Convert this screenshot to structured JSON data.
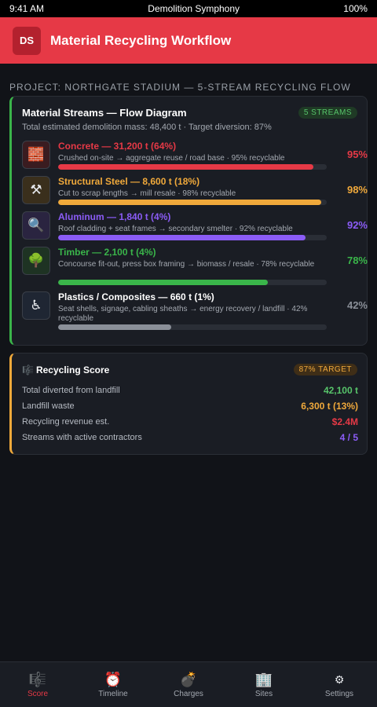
{
  "status_bar": {
    "time": "9:41 AM",
    "carrier": "Demolition Symphony",
    "battery": "100%"
  },
  "header": {
    "logo": "DS",
    "title": "Material Recycling Workflow"
  },
  "project_label": "PROJECT: NORTHGATE STADIUM — 5-STREAM RECYCLING FLOW",
  "flow_card": {
    "title": "Material Streams — Flow Diagram",
    "badge": "5 STREAMS",
    "subtitle": "Total estimated demolition mass: 48,400 t · Target diversion: 87%",
    "streams": [
      {
        "icon": "brick-icon",
        "glyph": "🧱",
        "name": "Concrete — 31,200 t (64%)",
        "desc": "Crushed on-site → aggregate reuse / road base · 95% recyclable",
        "pct": "95%",
        "fill": 0.95,
        "color": "#e63946",
        "icon_bg": "#3a1c20"
      },
      {
        "icon": "hammer-pick-icon",
        "glyph": "⚒",
        "name": "Structural Steel — 8,600 t (18%)",
        "desc": "Cut to scrap lengths → mill resale · 98% recyclable",
        "pct": "98%",
        "fill": 0.98,
        "color": "#f0a93b",
        "icon_bg": "#3a2f1c"
      },
      {
        "icon": "magnifier-icon",
        "glyph": "🔍",
        "name": "Aluminum — 1,840 t (4%)",
        "desc": "Roof cladding + seat frames → secondary smelter · 92% recyclable",
        "pct": "92%",
        "fill": 0.92,
        "color": "#8b5cf6",
        "icon_bg": "#2a2440"
      },
      {
        "icon": "tree-icon",
        "glyph": "🌳",
        "name": "Timber — 2,100 t (4%)",
        "desc": "Concourse fit-out, press box framing → biomass / resale · 78% recyclable",
        "pct": "78%",
        "fill": 0.78,
        "color": "#3ab54a",
        "icon_bg": "#1e3323"
      },
      {
        "icon": "wheelchair-icon",
        "glyph": "♿",
        "name": "Plastics / Composites — 660 t (1%)",
        "desc": "Seat shells, signage, cabling sheaths → energy recovery / landfill · 42% recyclable",
        "pct": "42%",
        "fill": 0.42,
        "color": "#8a8f98",
        "name_color": "#ffffff",
        "icon_bg": "#1f2633"
      }
    ]
  },
  "score_card": {
    "title": "Recycling Score",
    "title_icon": "music-score-icon",
    "badge": "87% TARGET",
    "rows": [
      {
        "label": "Total diverted from landfill",
        "value": "42,100 t",
        "color": "#57c46a"
      },
      {
        "label": "Landfill waste",
        "value": "6,300 t (13%)",
        "color": "#f0a93b"
      },
      {
        "label": "Recycling revenue est.",
        "value": "$2.4M",
        "color": "#e63946"
      },
      {
        "label": "Streams with active contractors",
        "value": "4 / 5",
        "color": "#8b5cf6"
      }
    ]
  },
  "tabs": [
    {
      "label": "Score",
      "icon": "music-score-icon",
      "glyph": "🎼",
      "active": true
    },
    {
      "label": "Timeline",
      "icon": "alarm-clock-icon",
      "glyph": "⏰",
      "active": false
    },
    {
      "label": "Charges",
      "icon": "bomb-icon",
      "glyph": "💣",
      "active": false
    },
    {
      "label": "Sites",
      "icon": "building-icon",
      "glyph": "🏢",
      "active": false
    },
    {
      "label": "Settings",
      "icon": "gear-icon",
      "glyph": "⚙",
      "active": false
    }
  ]
}
